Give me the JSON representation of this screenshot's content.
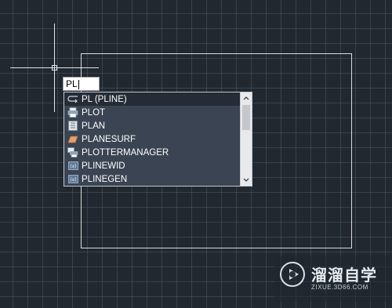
{
  "command_input": {
    "value": "PL"
  },
  "autocomplete": {
    "items": [
      {
        "label": "PL (PLINE)",
        "icon": "pline-icon",
        "selected": true
      },
      {
        "label": "PLOT",
        "icon": "printer-icon"
      },
      {
        "label": "PLAN",
        "icon": "plan-icon"
      },
      {
        "label": "PLANESURF",
        "icon": "planesurf-icon"
      },
      {
        "label": "PLOTTERMANAGER",
        "icon": "plotter-manager-icon"
      },
      {
        "label": "PLINEWID",
        "icon": "system-variable-icon"
      },
      {
        "label": "PLINEGEN",
        "icon": "system-variable-icon"
      }
    ],
    "scroll_up": "▲",
    "scroll_down": "▼"
  },
  "watermark": {
    "title": "溜溜自学",
    "url": "ZIXUE.3D66.COM"
  },
  "colors": {
    "background": "#212830",
    "dropdown": "#3a4452",
    "selected_row": "#252c36",
    "canvas_lines": "#dcdcdc"
  }
}
